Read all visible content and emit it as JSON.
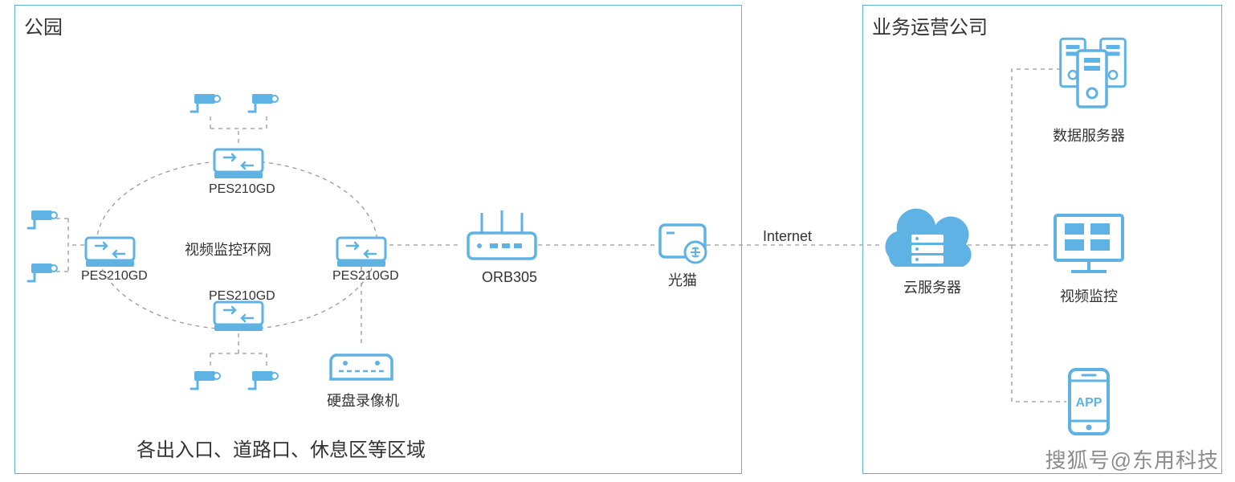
{
  "left_panel": {
    "title": "公园",
    "footer": "各出入口、道路口、休息区等区域",
    "ring_label": "视频监控环网",
    "switch_label": "PES210GD",
    "router_label": "ORB305",
    "modem_label": "光猫",
    "nvr_label": "硬盘录像机",
    "internet_label": "Internet"
  },
  "right_panel": {
    "title": "业务运营公司",
    "data_server_label": "数据服务器",
    "cloud_label": "云服务器",
    "video_monitor_label": "视频监控",
    "app_label": "APP"
  },
  "watermark": "搜狐号@东用科技",
  "colors": {
    "accent": "#5EB3E4",
    "dash": "#999999"
  }
}
